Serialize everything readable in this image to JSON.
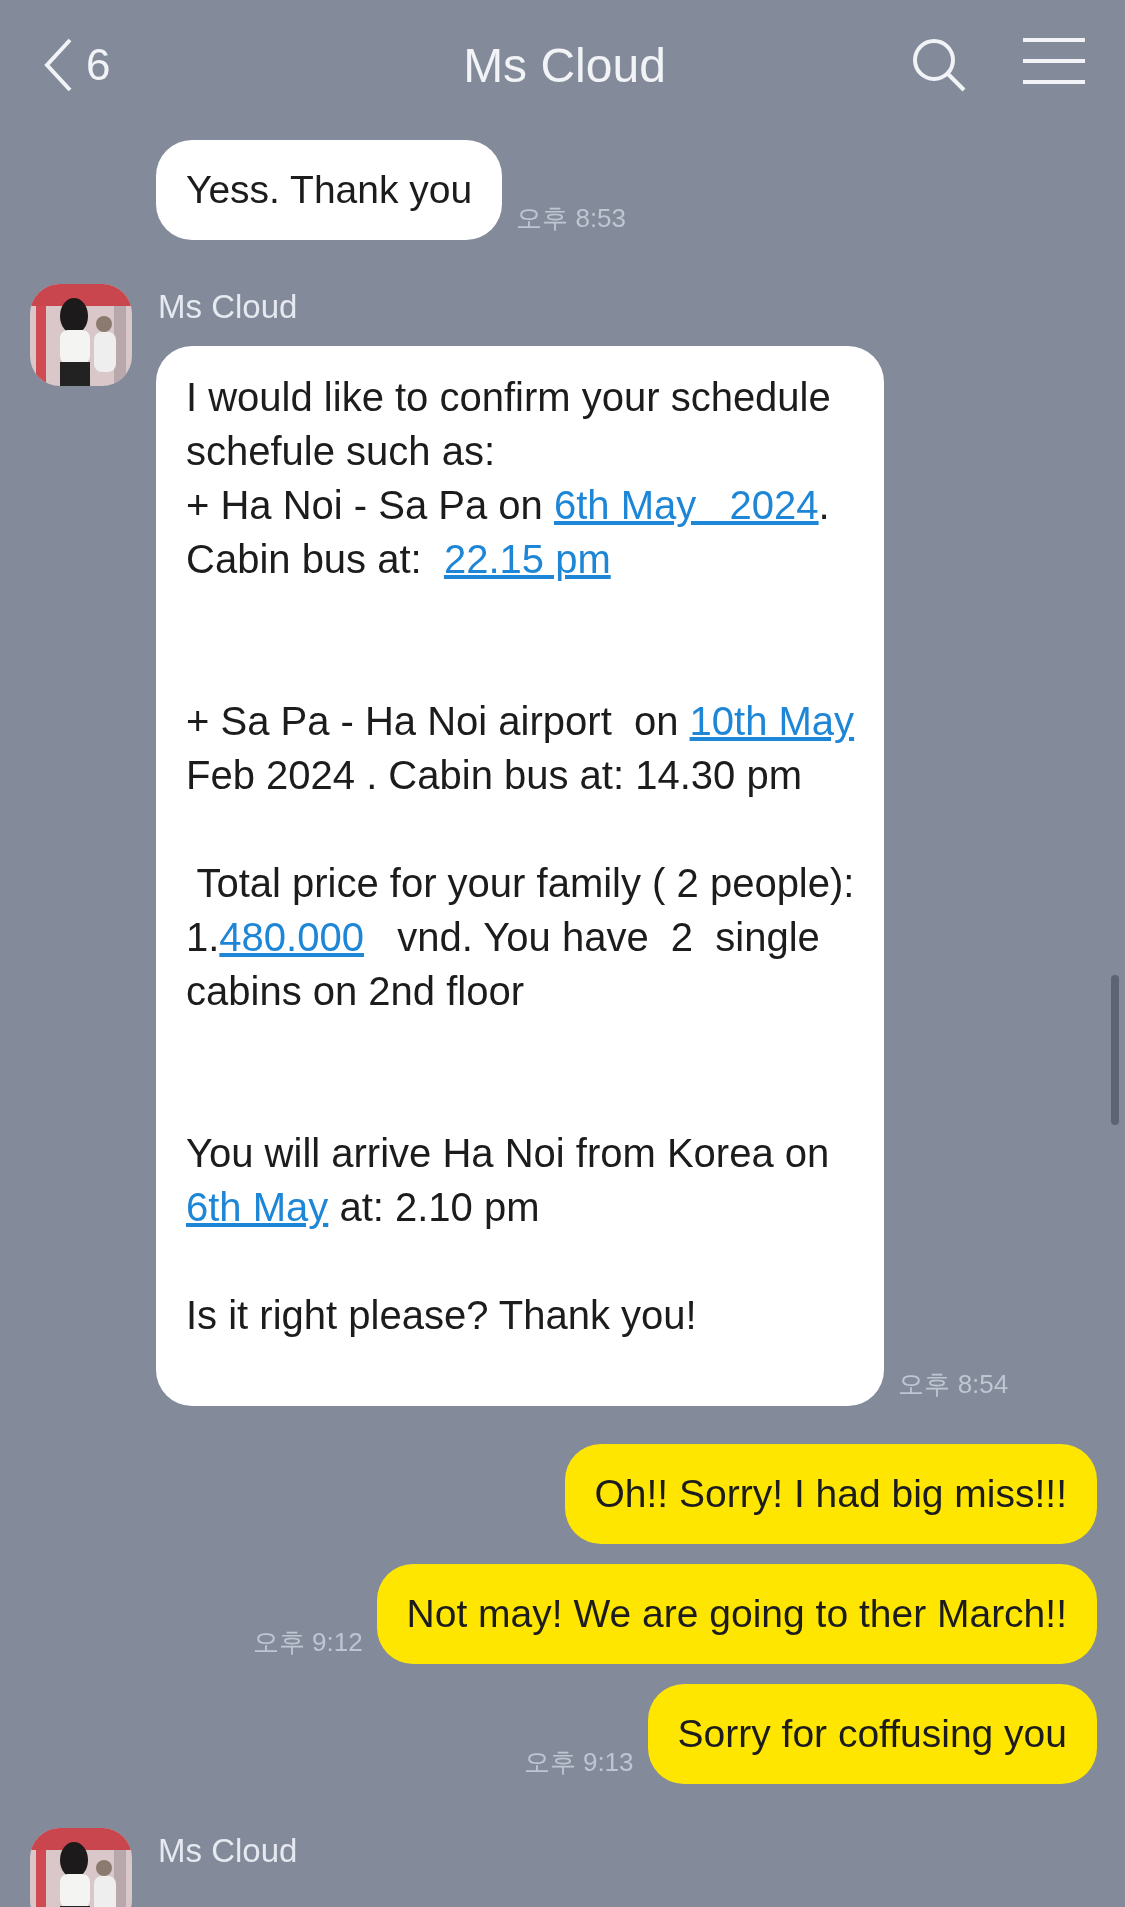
{
  "header": {
    "back_count": "6",
    "title": "Ms Cloud"
  },
  "messages": [
    {
      "kind": "received",
      "text": "Yess. Thank you",
      "time": "오후 8:53"
    },
    {
      "kind": "received",
      "sender": "Ms Cloud",
      "time": "오후 8:54",
      "paragraphs": [
        {
          "kind": "lead",
          "lines": [
            [
              {
                "kind": "plain",
                "text": "I would like to confirm your schedule"
              }
            ],
            [
              {
                "kind": "plain",
                "text": "schefule such as:"
              }
            ],
            [
              {
                "kind": "plain",
                "text": "+ Ha Noi - Sa Pa on "
              },
              {
                "kind": "link",
                "text": "6th May   2024"
              },
              {
                "kind": "plain",
                "text": "."
              }
            ],
            [
              {
                "kind": "plain",
                "text": "Cabin bus at:  "
              },
              {
                "kind": "link",
                "text": "22.15 pm"
              }
            ]
          ]
        },
        {
          "kind": "wide",
          "lines": [
            [
              {
                "kind": "plain",
                "text": "+ Sa Pa - Ha Noi airport  on "
              },
              {
                "kind": "link",
                "text": "10th May"
              }
            ],
            [
              {
                "kind": "plain",
                "text": "Feb 2024 . Cabin bus at: 14.30 pm"
              }
            ]
          ]
        },
        {
          "kind": "narrow",
          "lines": [
            [
              {
                "kind": "plain",
                "text": " Total price for your family ( 2 people):"
              }
            ],
            [
              {
                "kind": "plain",
                "text": "1."
              },
              {
                "kind": "link",
                "text": "480.000"
              },
              {
                "kind": "plain",
                "text": "   vnd. You have  2  single"
              }
            ],
            [
              {
                "kind": "plain",
                "text": "cabins on 2nd floor"
              }
            ]
          ]
        },
        {
          "kind": "wide",
          "lines": [
            [
              {
                "kind": "plain",
                "text": "You will arrive Ha Noi from Korea on"
              }
            ],
            [
              {
                "kind": "link",
                "text": "6th May"
              },
              {
                "kind": "plain",
                "text": " at: 2.10 pm"
              }
            ]
          ]
        },
        {
          "kind": "narrow",
          "lines": [
            [
              {
                "kind": "plain",
                "text": "Is it right please? Thank you!"
              }
            ]
          ]
        }
      ]
    },
    {
      "kind": "sent",
      "text": "Oh!! Sorry! I had big miss!!!"
    },
    {
      "kind": "sent",
      "text": "Not may! We are going to ther March!!",
      "time": "오후 9:12"
    },
    {
      "kind": "sent",
      "text": "Sorry for coffusing you",
      "time": "오후 9:13"
    },
    {
      "kind": "received",
      "sender": "Ms Cloud"
    }
  ]
}
